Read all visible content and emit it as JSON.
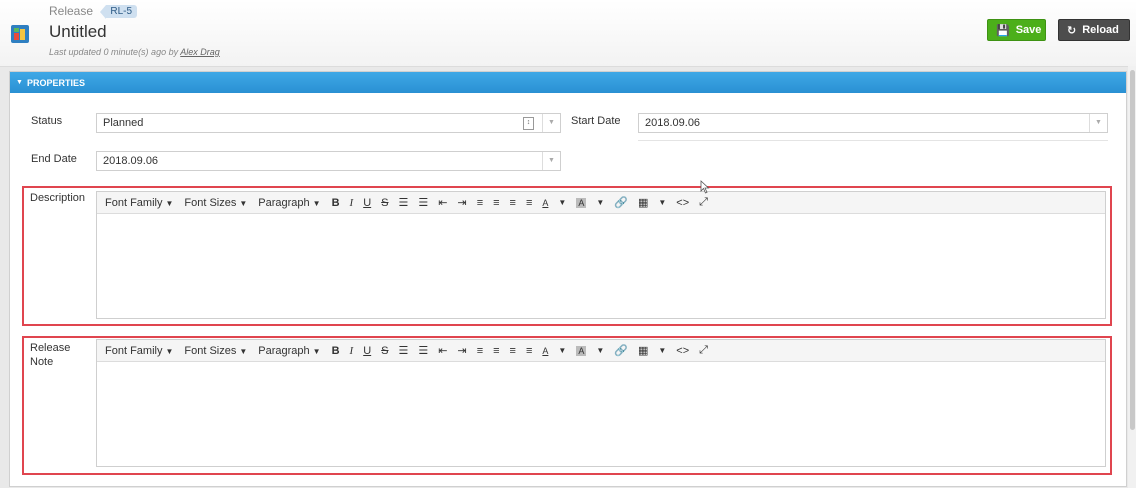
{
  "header": {
    "breadcrumb": "Release",
    "tag": "RL-5",
    "title": "Untitled",
    "updated_prefix": "Last updated 0 minute(s) ago by ",
    "updated_user": "Alex Drag",
    "save_label": "Save",
    "reload_label": "Reload"
  },
  "panel": {
    "title": "PROPERTIES"
  },
  "fields": {
    "status_label": "Status",
    "status_value": "Planned",
    "start_date_label": "Start Date",
    "start_date_value": "2018.09.06",
    "end_date_label": "End Date",
    "end_date_value": "2018.09.06",
    "description_label": "Description",
    "release_note_label_1": "Release",
    "release_note_label_2": "Note"
  },
  "toolbar": {
    "font_family": "Font Family",
    "font_sizes": "Font Sizes",
    "paragraph": "Paragraph",
    "bold": "B",
    "italic": "I",
    "underline": "U",
    "strike": "S",
    "text_color": "A",
    "bg_color": "A"
  },
  "colors": {
    "accent": "#2a90d3",
    "save": "#4caf1a",
    "reload": "#4d4d4d",
    "highlight_box": "#e0454f"
  }
}
